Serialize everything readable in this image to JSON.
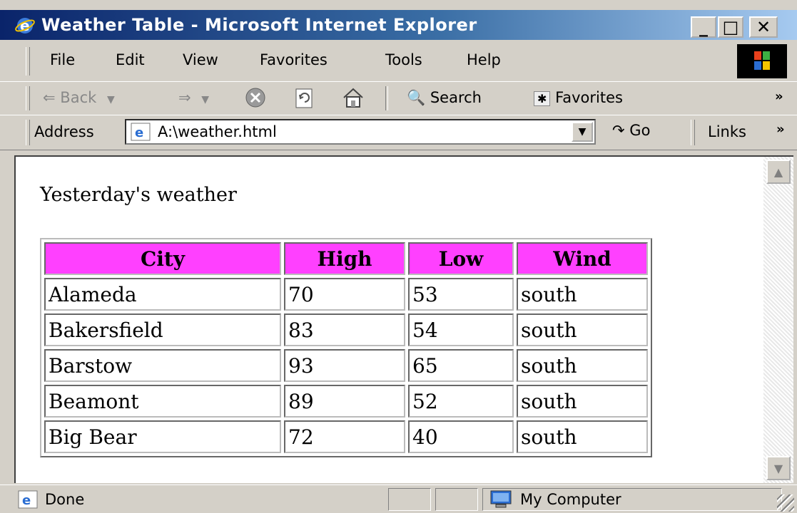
{
  "window": {
    "title": "Weather Table - Microsoft Internet Explorer",
    "minimize": "_",
    "maximize": "□",
    "close": "✕"
  },
  "menu": {
    "items": [
      "File",
      "Edit",
      "View",
      "Favorites",
      "Tools",
      "Help"
    ]
  },
  "toolbar": {
    "back": "Back",
    "search": "Search",
    "favorites": "Favorites",
    "more": "»"
  },
  "address": {
    "label": "Address",
    "value": "A:\\weather.html",
    "go": "Go",
    "links": "Links",
    "more": "»"
  },
  "page": {
    "heading": "Yesterday's weather",
    "table": {
      "headers": [
        "City",
        "High",
        "Low",
        "Wind"
      ],
      "rows": [
        [
          "Alameda",
          "70",
          "53",
          "south"
        ],
        [
          "Bakersfield",
          "83",
          "54",
          "south"
        ],
        [
          "Barstow",
          "93",
          "65",
          "south"
        ],
        [
          "Beamont",
          "89",
          "52",
          "south"
        ],
        [
          "Big Bear",
          "72",
          "40",
          "south"
        ]
      ]
    },
    "header_color": "#ff40ff"
  },
  "status": {
    "text": "Done",
    "zone": "My Computer"
  }
}
